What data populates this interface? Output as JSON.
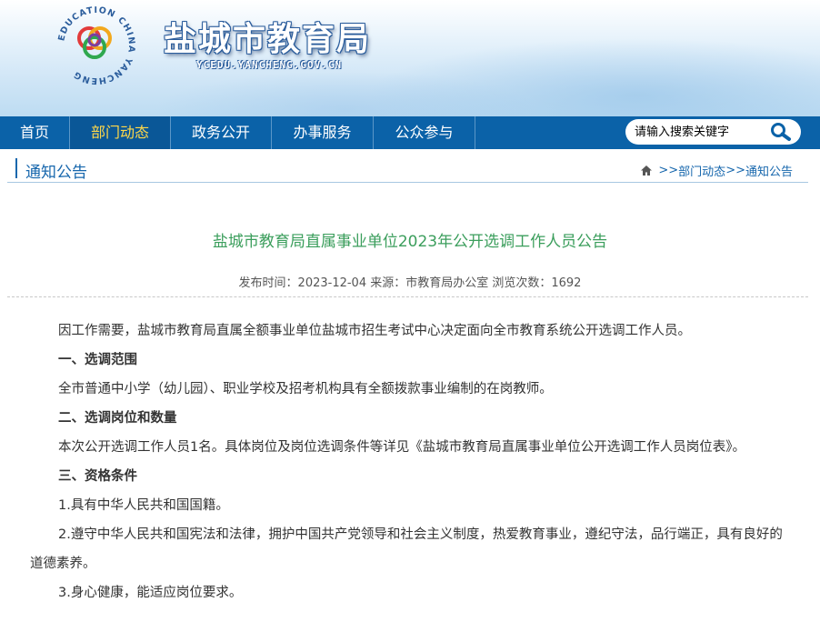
{
  "header": {
    "site_title": "盐城市教育局",
    "site_domain": "YCEDU.YANCHENG.GOV.CN",
    "emblem_text": "EDUCATION CHINA YANCHENG"
  },
  "nav": {
    "items": [
      {
        "label": "首页"
      },
      {
        "label": "部门动态"
      },
      {
        "label": "政务公开"
      },
      {
        "label": "办事服务"
      },
      {
        "label": "公众参与"
      }
    ],
    "active_index": 1,
    "search_placeholder": "请输入搜索关键字",
    "search_value": ""
  },
  "section": {
    "title": "通知公告",
    "breadcrumb": [
      ">>",
      "部门动态",
      ">>",
      "通知公告"
    ]
  },
  "article": {
    "title": "盐城市教育局直属事业单位2023年公开选调工作人员公告",
    "meta": "发布时间：2023-12-04 来源：市教育局办公室 浏览次数：1692",
    "paragraphs": [
      "因工作需要，盐城市教育局直属全额事业单位盐城市招生考试中心决定面向全市教育系统公开选调工作人员。",
      "一、选调范围",
      "全市普通中小学（幼儿园）、职业学校及招考机构具有全额拨款事业编制的在岗教师。",
      "二、选调岗位和数量",
      "本次公开选调工作人员1名。具体岗位及岗位选调条件等详见《盐城市教育局直属事业单位公开选调工作人员岗位表》。",
      "三、资格条件",
      "1.具有中华人民共和国国籍。",
      "2.遵守中华人民共和国宪法和法律，拥护中国共产党领导和社会主义制度，热爱教育事业，遵纪守法，品行端正，具有良好的道德素养。",
      "3.身心健康，能适应岗位要求。"
    ]
  },
  "colors": {
    "nav_bg": "#0b62a8",
    "nav_active_text": "#ffd84a",
    "title_green": "#3b9e5c",
    "link_blue": "#1767ad"
  }
}
